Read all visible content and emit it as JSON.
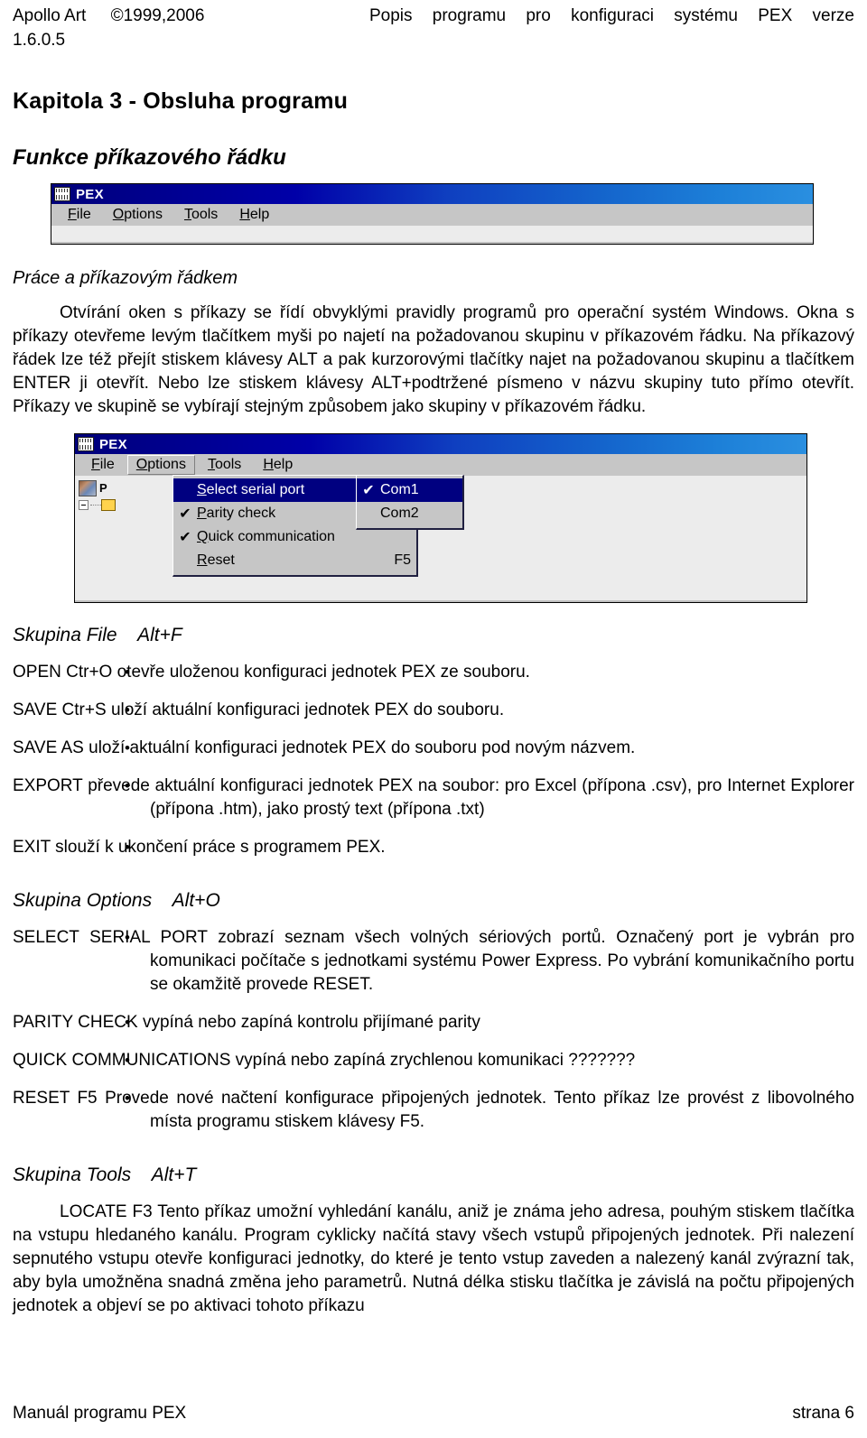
{
  "header": {
    "brand": "Apollo Art",
    "copyright": "©1999,2006",
    "doc_title": "Popis programu pro konfiguraci systému PEX verze",
    "version": "1.6.0.5"
  },
  "chapter_title": "Kapitola 3 - Obsluha programu",
  "section_title": "Funkce příkazového řádku",
  "subsection_title": "Práce a příkazovým řádkem",
  "intro_paragraph": "Otvírání oken s příkazy se řídí obvyklými pravidly programů pro operační systém Windows. Okna s příkazy otevřeme levým tlačítkem myši po najetí na požadovanou skupinu v příkazovém řádku. Na příkazový řádek lze též přejít stiskem klávesy ALT a pak kurzorovými tlačítky najet na požadovanou skupinu a tlačítkem ENTER ji otevřít. Nebo lze stiskem klávesy ALT+podtržené písmeno v názvu skupiny tuto přímo otevřít. Příkazy ve skupině se vybírají stejným způsobem jako skupiny v příkazovém řádku.",
  "window1": {
    "title": "PEX",
    "icon": "pex-app-icon",
    "menu": [
      {
        "mnemonic": "F",
        "rest": "ile"
      },
      {
        "mnemonic": "O",
        "rest": "ptions"
      },
      {
        "mnemonic": "T",
        "rest": "ools"
      },
      {
        "mnemonic": "H",
        "rest": "elp"
      }
    ]
  },
  "window2": {
    "title": "PEX",
    "icon": "pex-app-icon",
    "menu": [
      {
        "mnemonic": "F",
        "rest": "ile",
        "open": false
      },
      {
        "mnemonic": "O",
        "rest": "ptions",
        "open": true
      },
      {
        "mnemonic": "T",
        "rest": "ools",
        "open": false
      },
      {
        "mnemonic": "H",
        "rest": "elp",
        "open": false
      }
    ],
    "options_menu": [
      {
        "check": "",
        "mnemonic": "S",
        "rest": "elect serial port",
        "accel": "",
        "arrow": "▶",
        "highlight": true
      },
      {
        "check": "✔",
        "mnemonic": "P",
        "rest": "arity check",
        "accel": "",
        "arrow": "",
        "highlight": false
      },
      {
        "check": "✔",
        "mnemonic": "Q",
        "rest": "uick communication",
        "accel": "",
        "arrow": "",
        "highlight": false
      },
      {
        "check": "",
        "mnemonic": "R",
        "rest": "eset",
        "accel": "F5",
        "arrow": "",
        "highlight": false
      }
    ],
    "serial_submenu": [
      {
        "check": "✔",
        "label": "Com1",
        "highlight": true
      },
      {
        "check": "",
        "label": "Com2",
        "highlight": false
      }
    ]
  },
  "group_file": {
    "heading": "Skupina File",
    "shortcut": "Alt+F",
    "items": [
      {
        "term": "OPEN   Ctr+O",
        "desc": "otevře uloženou konfiguraci jednotek PEX ze souboru."
      },
      {
        "term": "SAVE   Ctr+S",
        "desc": "uloží aktuální konfiguraci jednotek PEX do souboru."
      },
      {
        "term": "SAVE AS",
        "desc": "uloží aktuální konfiguraci jednotek PEX do souboru pod novým názvem."
      },
      {
        "term": "EXPORT",
        "desc": "převede aktuální konfiguraci jednotek PEX na soubor: pro  Excel (přípona .csv), pro Internet Explorer (přípona .htm), jako prostý text (přípona .txt)"
      },
      {
        "term": "EXIT",
        "desc": "slouží k ukončení práce s programem PEX."
      }
    ]
  },
  "group_options": {
    "heading": "Skupina Options",
    "shortcut": "Alt+O",
    "items": [
      {
        "term": "SELECT SERIAL PORT",
        "desc": "zobrazí seznam všech volných sériových portů. Označený port je vybrán pro komunikaci počítače s jednotkami systému Power Express. Po vybrání komunikačního portu se okamžitě provede RESET."
      },
      {
        "term": "PARITY CHECK",
        "desc": "vypíná nebo zapíná kontrolu přijímané parity"
      },
      {
        "term": "QUICK COMMUNICATIONS",
        "desc": "vypíná nebo zapíná zrychlenou komunikaci ???????"
      },
      {
        "term": "RESET  F5",
        "desc": "Provede nové načtení konfigurace připojených jednotek. Tento příkaz lze provést z libovolného místa programu stiskem klávesy F5."
      }
    ]
  },
  "group_tools": {
    "heading": "Skupina Tools",
    "shortcut": "Alt+T",
    "paragraph": "LOCATE  F3   Tento příkaz umožní vyhledání kanálu, aniž je známa jeho adresa, pouhým stiskem tlačítka na vstupu hledaného kanálu. Program cyklicky načítá stavy všech vstupů připojených jednotek. Při nalezení sepnutého vstupu otevře konfiguraci jednotky, do které je tento vstup zaveden a nalezený kanál zvýrazní tak, aby byla umožněna snadná změna jeho parametrů. Nutná délka stisku tlačítka je závislá na počtu připojených jednotek a objeví se po aktivaci tohoto příkazu"
  },
  "footer": {
    "left": "Manuál programu PEX",
    "right": "strana 6"
  },
  "colors": {
    "titlebar_start": "#00007a",
    "titlebar_end": "#2a8fe0",
    "menu_face": "#c6c6c6",
    "menu_highlight": "#000080",
    "client": "#ececec"
  }
}
